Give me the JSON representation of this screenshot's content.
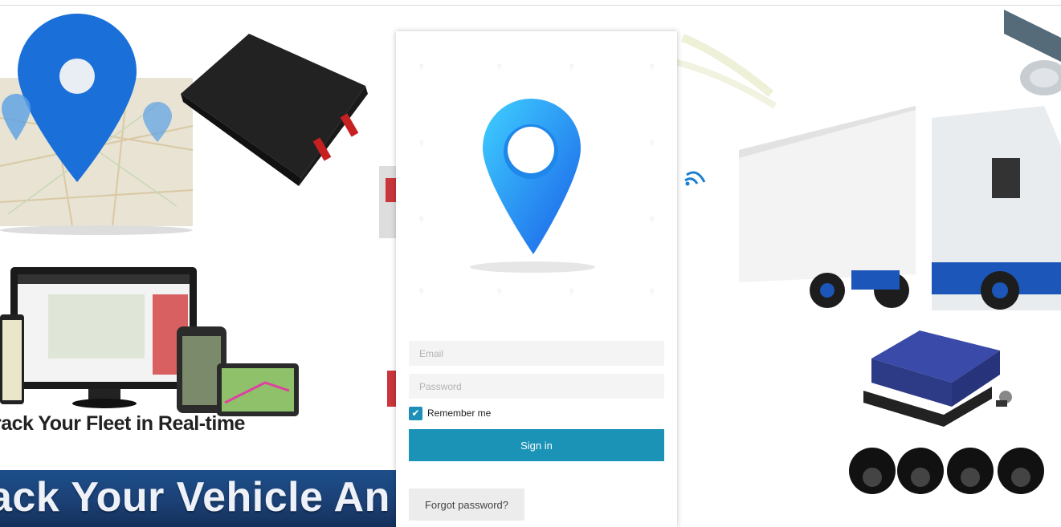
{
  "background": {
    "tagline": "rack Your Fleet in Real-time",
    "banner_text": "ack Your Vehicle An",
    "icons": [
      "map-pin-icon",
      "gps-tracker-device",
      "monitor-screens",
      "truck-image",
      "dvr-device",
      "dome-camera-icon",
      "satellite-dish-icon",
      "wifi-signal-icon"
    ]
  },
  "login": {
    "logo_icon": "map-pin-icon",
    "email_placeholder": "Email",
    "password_placeholder": "Password",
    "remember_label": "Remember me",
    "remember_checked": true,
    "signin_label": "Sign in",
    "forgot_label": "Forgot password?"
  },
  "colors": {
    "accent": "#1b93b6",
    "pin": "#1a78e8",
    "banner": "#1b3f73"
  }
}
